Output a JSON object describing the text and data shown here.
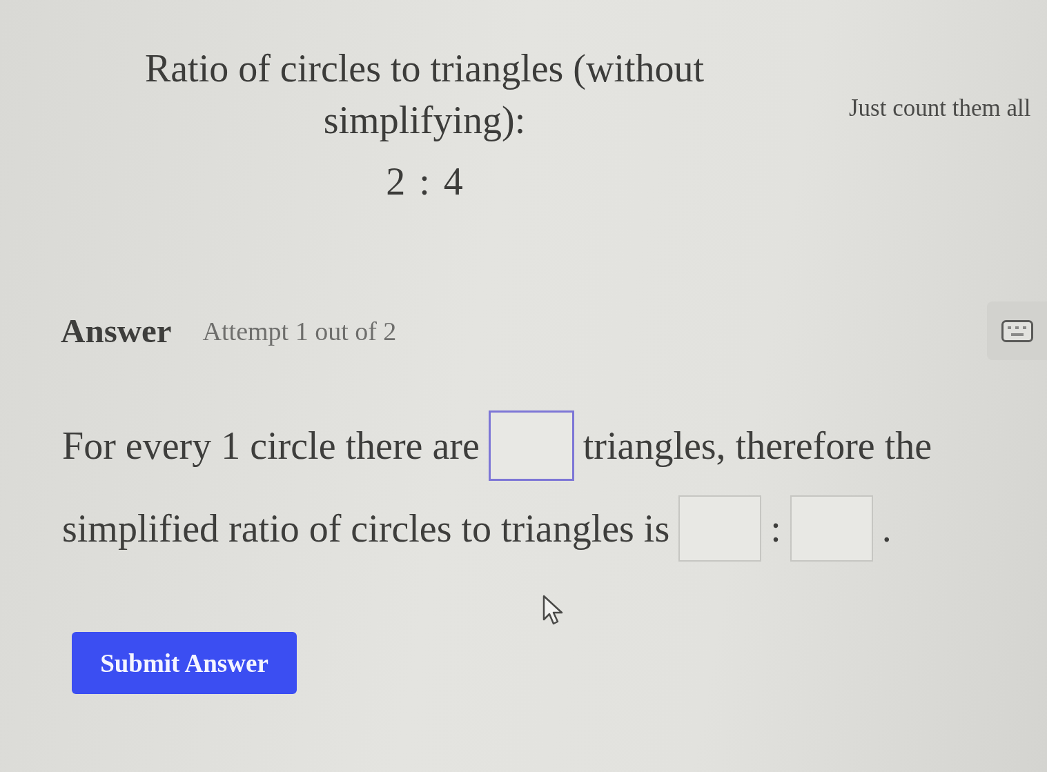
{
  "question": {
    "prompt": "Ratio of circles to triangles (without simplifying):",
    "ratio": "2 : 4",
    "hint": "Just count them all"
  },
  "answer": {
    "heading": "Answer",
    "attempt": "Attempt 1 out of 2"
  },
  "sentence": {
    "lines": [
      [
        {
          "kind": "text",
          "text": "For every 1 circle there are"
        },
        {
          "kind": "blank",
          "focused": true
        },
        {
          "kind": "text",
          "text": "triangles, therefore the"
        }
      ],
      [
        {
          "kind": "text",
          "text": "simplified ratio of circles to triangles is"
        },
        {
          "kind": "blank",
          "focused": false
        },
        {
          "kind": "text",
          "text": ":"
        },
        {
          "kind": "blank",
          "focused": false
        },
        {
          "kind": "text",
          "text": "."
        }
      ]
    ]
  },
  "submit_button": {
    "label": "Submit Answer"
  }
}
